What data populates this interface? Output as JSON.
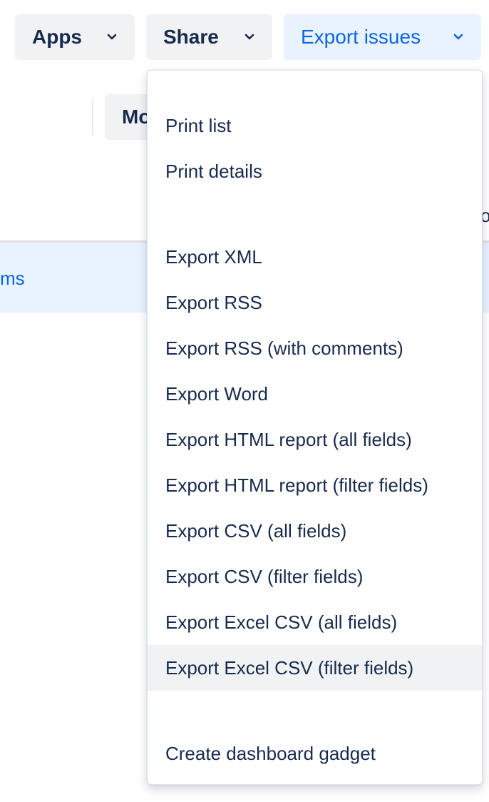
{
  "toolbar": {
    "apps_label": "Apps",
    "share_label": "Share",
    "export_label": "Export issues"
  },
  "background": {
    "more_button_partial": "Mo",
    "selected_row_text_partial": "ms",
    "edge_text_partial": "o"
  },
  "menu": {
    "print_items": [
      "Print list",
      "Print details"
    ],
    "export_items": [
      "Export XML",
      "Export RSS",
      "Export RSS (with comments)",
      "Export Word",
      "Export HTML report (all fields)",
      "Export HTML report (filter fields)",
      "Export CSV (all fields)",
      "Export CSV (filter fields)",
      "Export Excel CSV (all fields)",
      "Export Excel CSV (filter fields)"
    ],
    "gadget_items": [
      "Create dashboard gadget"
    ],
    "highlighted_item": "Export Excel CSV (filter fields)"
  },
  "colors": {
    "text": "#172b4d",
    "accent": "#0c66e4",
    "accent_bg": "#e9f2ff",
    "button_bg": "#f1f2f4"
  },
  "icons": {
    "toolbar_dropdown": "chevron-down-icon"
  }
}
